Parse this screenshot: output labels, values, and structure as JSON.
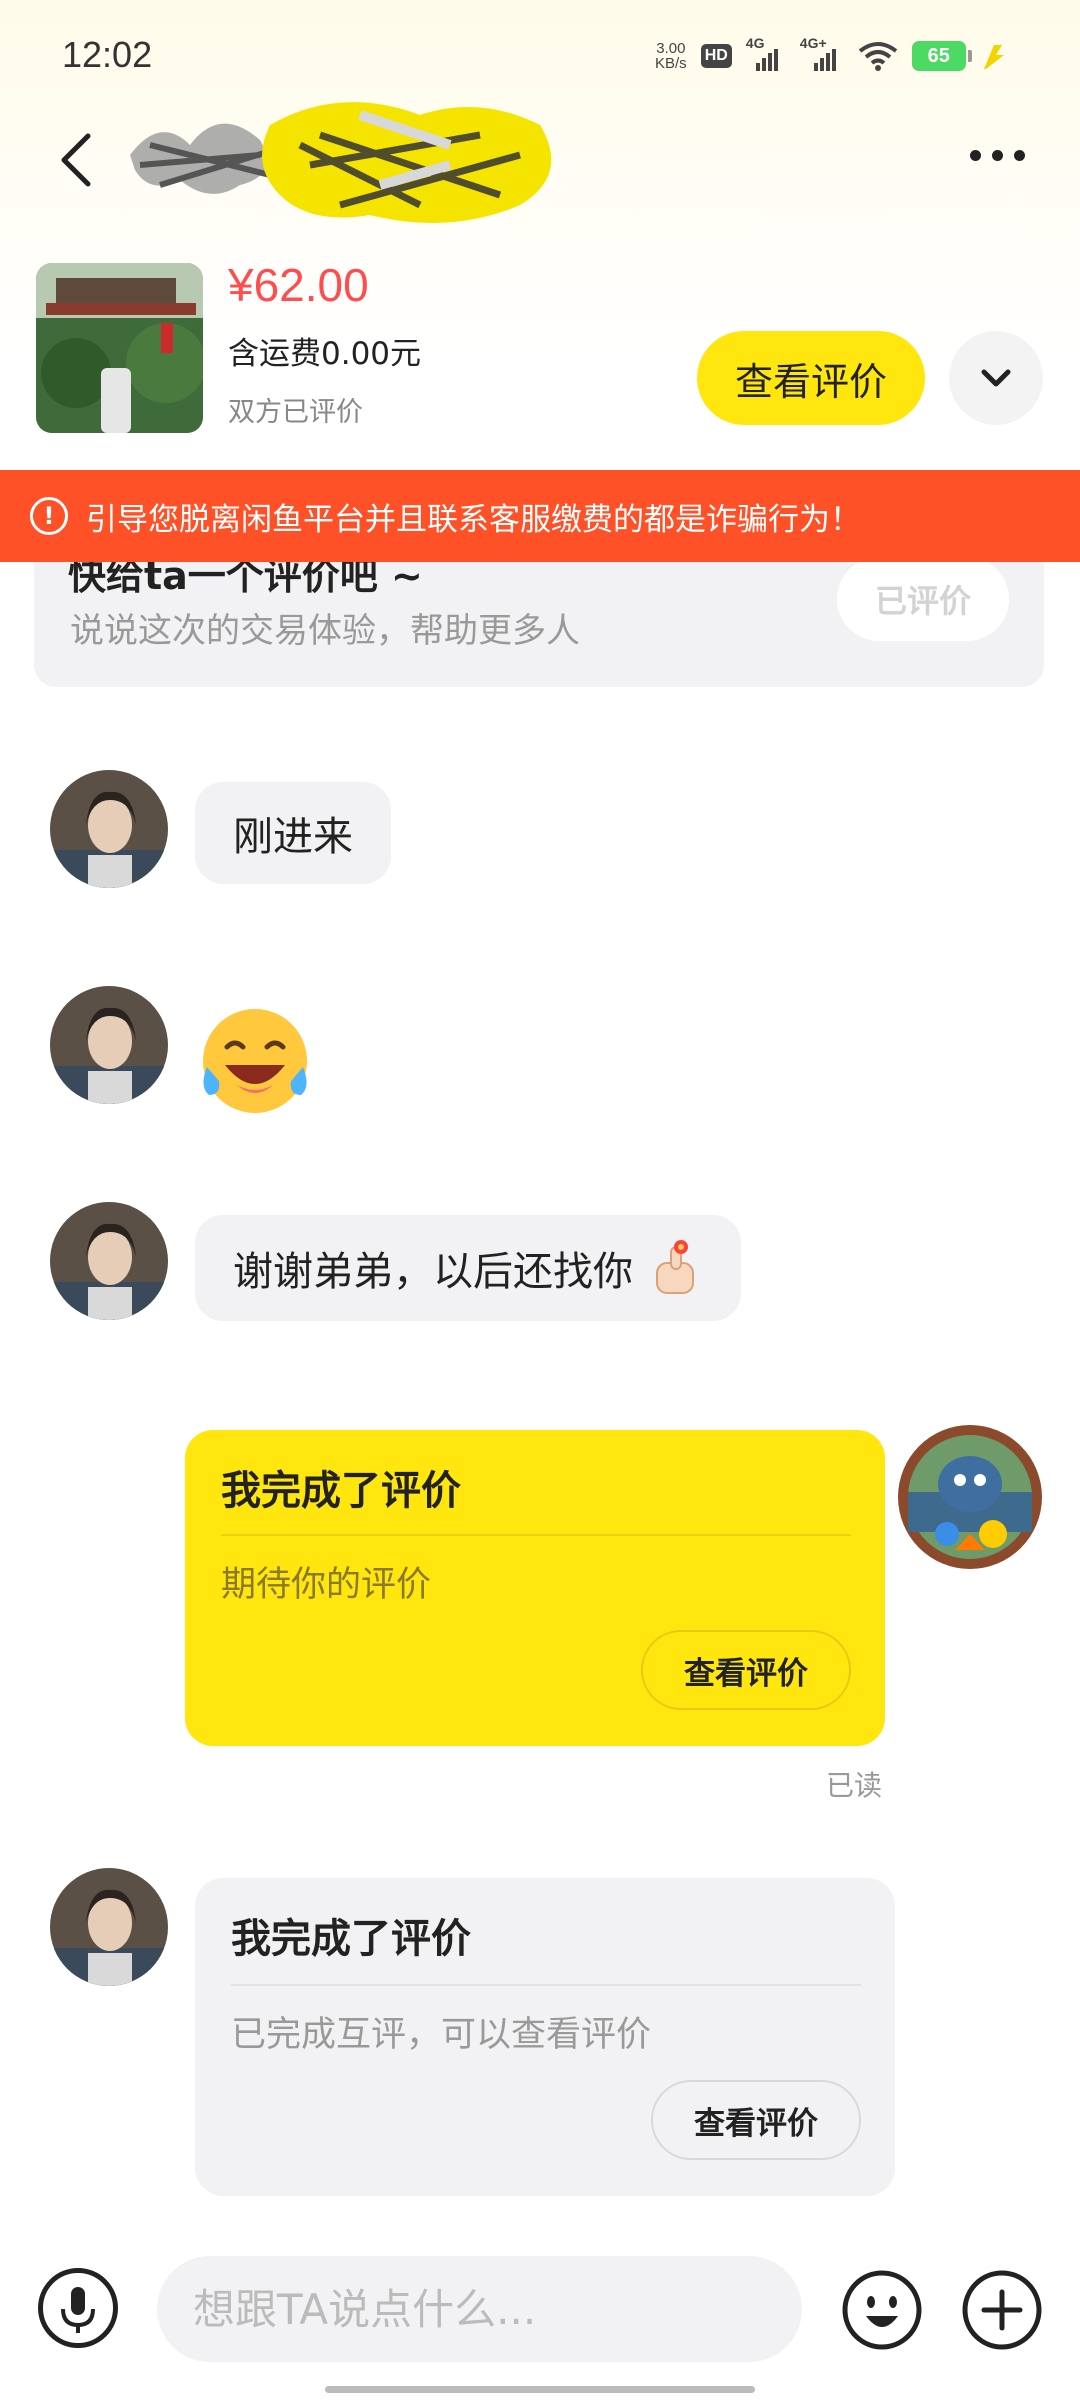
{
  "status_bar": {
    "time": "12:02",
    "speed_value": "3.00",
    "speed_unit": "KB/s",
    "hd_label": "HD",
    "sim1_label": "4G",
    "sim2_label": "4G+",
    "battery": "65"
  },
  "product": {
    "price": "¥62.00",
    "shipping": "含运费0.00元",
    "rating_status": "双方已评价",
    "view_reviews_button": "查看评价"
  },
  "warning": {
    "icon": "!",
    "text": "引导您脱离闲鱼平台并且联系客服缴费的都是诈骗行为！"
  },
  "review_prompt": {
    "title": "快给ta一个评价吧 ~",
    "subtitle": "说说这次的交易体验，帮助更多人",
    "button": "已评价"
  },
  "messages": {
    "m1": "刚进来",
    "m3": "谢谢弟弟，以后还找你",
    "my_card": {
      "title": "我完成了评价",
      "desc": "期待你的评价",
      "button": "查看评价",
      "status": "已读"
    },
    "their_card": {
      "title": "我完成了评价",
      "desc": "已完成互评，可以查看评价",
      "button": "查看评价"
    }
  },
  "input_bar": {
    "placeholder": "想跟TA说点什么..."
  },
  "colors": {
    "accent_yellow": "#ffe60f",
    "warning_red": "#ff5128",
    "price_red": "#ff4d4f"
  },
  "icons": [
    "back-arrow-icon",
    "more-icon",
    "chevron-down-icon",
    "alert-icon",
    "microphone-icon",
    "emoji-icon",
    "plus-icon"
  ]
}
